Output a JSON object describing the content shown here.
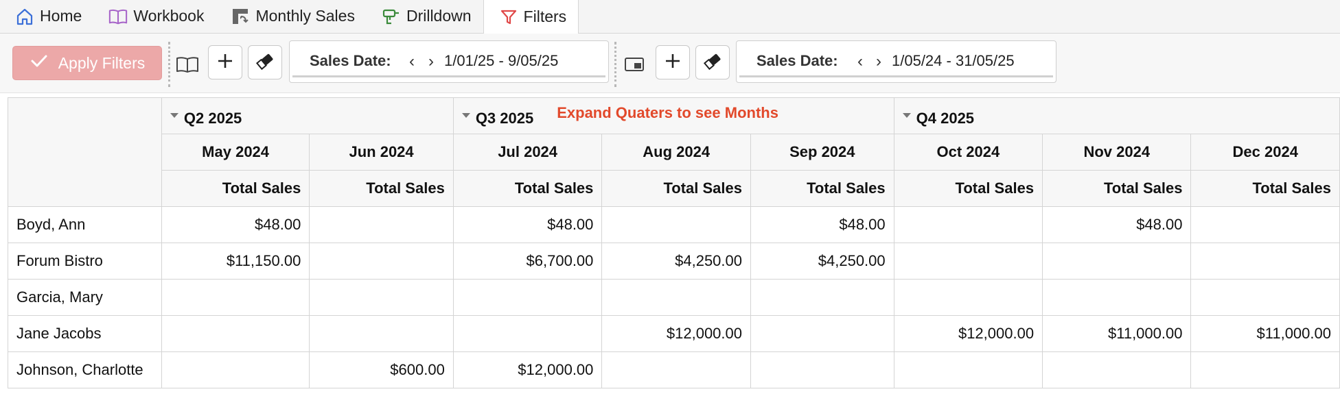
{
  "tabs": [
    {
      "label": "Home",
      "icon": "home-icon"
    },
    {
      "label": "Workbook",
      "icon": "book-icon"
    },
    {
      "label": "Monthly Sales",
      "icon": "pivot-icon"
    },
    {
      "label": "Drilldown",
      "icon": "drill-icon"
    },
    {
      "label": "Filters",
      "icon": "filter-icon"
    }
  ],
  "toolbar": {
    "apply_label": "Apply Filters",
    "filter1": {
      "label": "Sales Date:",
      "value": "1/01/25 - 9/05/25"
    },
    "filter2": {
      "label": "Sales Date:",
      "value": "1/05/24 - 31/05/25"
    }
  },
  "grid": {
    "quarters": [
      {
        "label": "Q2 2025"
      },
      {
        "label": "Q3 2025",
        "note": "Expand Quaters to see Months"
      },
      {
        "label": "Q4 2025"
      }
    ],
    "months": [
      "May 2024",
      "Jun 2024",
      "Jul 2024",
      "Aug 2024",
      "Sep 2024",
      "Oct 2024",
      "Nov 2024",
      "Dec 2024"
    ],
    "measure": "Total Sales",
    "rows": [
      {
        "name": "Boyd, Ann",
        "values": [
          "$48.00",
          "",
          "$48.00",
          "",
          "$48.00",
          "",
          "$48.00",
          ""
        ]
      },
      {
        "name": "Forum Bistro",
        "values": [
          "$11,150.00",
          "",
          "$6,700.00",
          "$4,250.00",
          "$4,250.00",
          "",
          "",
          ""
        ]
      },
      {
        "name": "Garcia, Mary",
        "values": [
          "",
          "",
          "",
          "",
          "",
          "",
          "",
          ""
        ]
      },
      {
        "name": "Jane Jacobs",
        "values": [
          "",
          "",
          "",
          "$12,000.00",
          "",
          "$12,000.00",
          "$11,000.00",
          "$11,000.00"
        ]
      },
      {
        "name": "Johnson, Charlotte",
        "values": [
          "",
          "$600.00",
          "$12,000.00",
          "",
          "",
          "",
          "",
          ""
        ]
      }
    ]
  },
  "colors": {
    "accent_apply": "#eca8a8",
    "note_red": "#e2492b",
    "home_blue": "#3b6fd8",
    "book_purple": "#a765c9",
    "drill_green": "#3a8a3a",
    "filter_red": "#e04848"
  }
}
